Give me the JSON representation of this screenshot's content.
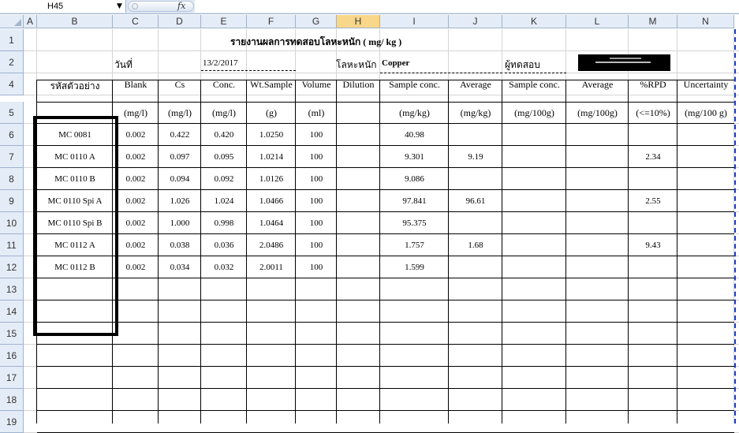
{
  "formula_bar": {
    "name_box": "H45",
    "fx": "fx",
    "formula": ""
  },
  "column_headers": [
    "A",
    "B",
    "C",
    "D",
    "E",
    "F",
    "G",
    "H",
    "I",
    "J",
    "K",
    "L",
    "M",
    "N"
  ],
  "selected_column": "H",
  "row_headers": [
    "1",
    "2",
    "4",
    "5",
    "6",
    "7",
    "8",
    "9",
    "10",
    "11",
    "12",
    "13",
    "14",
    "15",
    "16",
    "17",
    "18",
    "19"
  ],
  "report": {
    "title": "รายงานผลการทดสอบโลหะหนัก ( mg/ kg )",
    "date_label": "วันที่",
    "date_value": "13/2/2017",
    "metal_label": "โลหะหนัก",
    "metal_value": "Copper",
    "tester_label": "ผู้ทดสอบ"
  },
  "table": {
    "headers": [
      "รหัสตัวอย่าง",
      "Blank",
      "Cs",
      "Conc.",
      "Wt.Sample",
      "Volume",
      "Dilution",
      "Sample conc.",
      "Average",
      "Sample conc.",
      "Average",
      "%RPD",
      "Uncertainty"
    ],
    "units": [
      "",
      "(mg/l)",
      "(mg/l)",
      "(mg/l)",
      "(g)",
      "(ml)",
      "",
      "(mg/kg)",
      "(mg/kg)",
      "(mg/100g)",
      "(mg/100g)",
      "(<=10%)",
      "(mg/100 g)"
    ],
    "rows": [
      [
        "MC 0081",
        "0.002",
        "0.422",
        "0.420",
        "1.0250",
        "100",
        "",
        "40.98",
        "",
        "",
        "",
        "",
        ""
      ],
      [
        "MC 0110 A",
        "0.002",
        "0.097",
        "0.095",
        "1.0214",
        "100",
        "",
        "9.301",
        "9.19",
        "",
        "",
        "2.34",
        ""
      ],
      [
        "MC 0110 B",
        "0.002",
        "0.094",
        "0.092",
        "1.0126",
        "100",
        "",
        "9.086",
        "",
        "",
        "",
        "",
        ""
      ],
      [
        "MC 0110 Spi A",
        "0.002",
        "1.026",
        "1.024",
        "1.0466",
        "100",
        "",
        "97.841",
        "96.61",
        "",
        "",
        "2.55",
        ""
      ],
      [
        "MC 0110 Spi B",
        "0.002",
        "1.000",
        "0.998",
        "1.0464",
        "100",
        "",
        "95.375",
        "",
        "",
        "",
        "",
        ""
      ],
      [
        "MC 0112 A",
        "0.002",
        "0.038",
        "0.036",
        "2.0486",
        "100",
        "",
        "1.757",
        "1.68",
        "",
        "",
        "9.43",
        ""
      ],
      [
        "MC 0112 B",
        "0.002",
        "0.034",
        "0.032",
        "2.0011",
        "100",
        "",
        "1.599",
        "",
        "",
        "",
        "",
        ""
      ]
    ]
  },
  "colors": {
    "header_bg": "#e4ecf7",
    "selected_col": "#f8d68a",
    "page_break": "#1a3fc0"
  }
}
